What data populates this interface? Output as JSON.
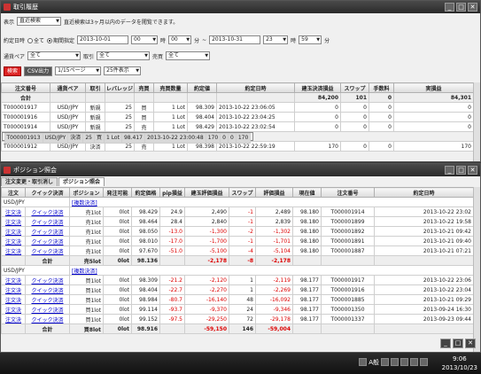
{
  "history": {
    "title": "取引履歴",
    "display_label": "表示",
    "display_value": "直近検索",
    "display_note": "直近検索は3ヶ月以内のデータを閲覧できます。",
    "period_label": "約定日時",
    "radio_all": "全て",
    "radio_range": "期間指定",
    "from_date": "2013-10-01",
    "from_hour": "00",
    "hour_unit": "時",
    "from_min": "00",
    "min_unit": "分",
    "tilde": "~",
    "to_date": "2013-10-31",
    "to_hour": "23",
    "to_min": "59",
    "pair_label": "通貨ペア",
    "pair_value": "全て",
    "trade_label": "取引",
    "trade_value": "全て",
    "side_label": "売買",
    "side_value": "全て",
    "search_btn": "検索",
    "csv_btn": "CSV出力",
    "page_value": "1/15ページ",
    "per_page_value": "25件表示",
    "headers": [
      "注文番号",
      "通貨ペア",
      "取引",
      "レバレッジ",
      "売買",
      "売買数量",
      "約定値",
      "約定日時",
      "建玉決済損益",
      "スワップ",
      "手数料",
      "実損益"
    ],
    "total": {
      "label": "合計",
      "pl": "84,200",
      "swap": "101",
      "fee": "0",
      "net": "84,301"
    },
    "rows": [
      [
        "T000001917",
        "USD/JPY",
        "新規",
        "25",
        "買",
        "1 Lot",
        "98.309",
        "2013-10-22 23:06:05",
        "0",
        "0",
        "0",
        "0"
      ],
      [
        "T000001916",
        "USD/JPY",
        "新規",
        "25",
        "買",
        "1 Lot",
        "98.404",
        "2013-10-22 23:04:25",
        "0",
        "0",
        "0",
        "0"
      ],
      [
        "T000001914",
        "USD/JPY",
        "新規",
        "25",
        "売",
        "1 Lot",
        "98.429",
        "2013-10-22 23:02:54",
        "0",
        "0",
        "0",
        "0"
      ],
      [
        "T000001913",
        "USD/JPY",
        "決済",
        "25",
        "買",
        "1 Lot",
        "98.417",
        "2013-10-22 23:00:48",
        "170",
        "0",
        "0",
        "170"
      ],
      [
        "T000001912",
        "USD/JPY",
        "決済",
        "25",
        "売",
        "1 Lot",
        "98.398",
        "2013-10-22 22:59:19",
        "170",
        "0",
        "0",
        "170"
      ]
    ]
  },
  "positions": {
    "title": "ポジション照会",
    "tabs": [
      "注文変更・取引消し",
      "ポジション照会"
    ],
    "headers": [
      "注文",
      "クイック決済",
      "ポジション",
      "発注可能",
      "約定価格",
      "pip損益",
      "建玉評価損益",
      "スワップ",
      "評価損益",
      "現在値",
      "注文番号",
      "約定日時"
    ],
    "groups": [
      {
        "pair": "USD/JPY",
        "bulk": "[複数決済]",
        "rows": [
          [
            "注文決",
            "クイック決済",
            "売1lot",
            "0lot",
            "98.429",
            "24.9",
            "2,490",
            "-1",
            "2,489",
            "98.180",
            "T000001914",
            "2013-10-22 23:02"
          ],
          [
            "注文決",
            "クイック決済",
            "売1lot",
            "0lot",
            "98.464",
            "28.4",
            "2,840",
            "-1",
            "2,839",
            "98.180",
            "T000001899",
            "2013-10-22 19:58"
          ],
          [
            "注文決",
            "クイック決済",
            "売1lot",
            "0lot",
            "98.050",
            "-13.0",
            "-1,300",
            "-2",
            "-1,302",
            "98.180",
            "T000001892",
            "2013-10-21 09:42"
          ],
          [
            "注文決",
            "クイック決済",
            "売1lot",
            "0lot",
            "98.010",
            "-17.0",
            "-1,700",
            "-1",
            "-1,701",
            "98.180",
            "T000001891",
            "2013-10-21 09:40"
          ],
          [
            "注文決",
            "クイック決済",
            "売1lot",
            "0lot",
            "97.670",
            "-51.0",
            "-5,100",
            "-4",
            "-5,104",
            "98.180",
            "T000001887",
            "2013-10-21 07:21"
          ]
        ],
        "sum": {
          "label": "合計",
          "pos": "売5lot",
          "avail": "0lot",
          "price": "98.136",
          "eval": "-2,178",
          "swap": "-8",
          "pl": "-2,178"
        }
      },
      {
        "pair": "USD/JPY",
        "bulk": "[複数決済]",
        "rows": [
          [
            "注文決",
            "クイック決済",
            "買1lot",
            "0lot",
            "98.309",
            "-21.2",
            "-2,120",
            "1",
            "-2,119",
            "98.177",
            "T000001917",
            "2013-10-22 23:06"
          ],
          [
            "注文決",
            "クイック決済",
            "買1lot",
            "0lot",
            "98.404",
            "-22.7",
            "-2,270",
            "1",
            "-2,269",
            "98.177",
            "T000001916",
            "2013-10-22 23:04"
          ],
          [
            "注文決",
            "クイック決済",
            "買1lot",
            "0lot",
            "98.984",
            "-80.7",
            "-16,140",
            "48",
            "-16,092",
            "98.177",
            "T000001885",
            "2013-10-21 09:29"
          ],
          [
            "注文決",
            "クイック決済",
            "買1lot",
            "0lot",
            "99.114",
            "-93.7",
            "-9,370",
            "24",
            "-9,346",
            "98.177",
            "T000001350",
            "2013-09-24 16:30"
          ],
          [
            "注文決",
            "クイック決済",
            "買1lot",
            "0lot",
            "99.152",
            "-97.5",
            "-29,250",
            "72",
            "-29,178",
            "98.177",
            "T000001337",
            "2013-09-23 09:44"
          ]
        ],
        "sum": {
          "label": "合計",
          "pos": "買8lot",
          "avail": "0lot",
          "price": "98.916",
          "eval": "-59,150",
          "swap": "146",
          "pl": "-59,004"
        }
      }
    ]
  },
  "taskbar": {
    "time": "9:06",
    "date": "2013/10/23",
    "ime": "A般"
  }
}
